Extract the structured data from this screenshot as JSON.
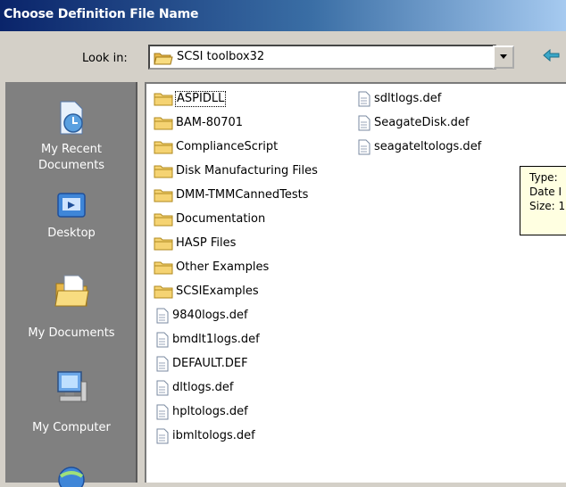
{
  "window": {
    "title": "Choose Definition File Name"
  },
  "lookin": {
    "label": "Look in:",
    "value": "SCSI toolbox32"
  },
  "places": [
    {
      "label_line1": "My Recent",
      "label_line2": "Documents",
      "icon": "recent-documents-icon"
    },
    {
      "label_line1": "Desktop",
      "label_line2": "",
      "icon": "desktop-icon"
    },
    {
      "label_line1": "My Documents",
      "label_line2": "",
      "icon": "my-documents-icon"
    },
    {
      "label_line1": "My Computer",
      "label_line2": "",
      "icon": "my-computer-icon"
    },
    {
      "label_line1": "",
      "label_line2": "",
      "icon": "network-icon"
    }
  ],
  "files": {
    "column1": [
      {
        "name": "ASPIDLL",
        "type": "folder"
      },
      {
        "name": "BAM-80701",
        "type": "folder"
      },
      {
        "name": "ComplianceScript",
        "type": "folder"
      },
      {
        "name": "Disk Manufacturing Files",
        "type": "folder"
      },
      {
        "name": "DMM-TMMCannedTests",
        "type": "folder"
      },
      {
        "name": "Documentation",
        "type": "folder"
      },
      {
        "name": "HASP Files",
        "type": "folder"
      },
      {
        "name": "Other Examples",
        "type": "folder"
      },
      {
        "name": "SCSIExamples",
        "type": "folder"
      },
      {
        "name": "9840logs.def",
        "type": "file"
      },
      {
        "name": "bmdlt1logs.def",
        "type": "file"
      },
      {
        "name": "DEFAULT.DEF",
        "type": "file"
      },
      {
        "name": "dltlogs.def",
        "type": "file"
      },
      {
        "name": "hpltologs.def",
        "type": "file"
      },
      {
        "name": "ibmltologs.def",
        "type": "file"
      }
    ],
    "column2": [
      {
        "name": "sdltlogs.def",
        "type": "file"
      },
      {
        "name": "SeagateDisk.def",
        "type": "file"
      },
      {
        "name": "seagateltologs.def",
        "type": "file"
      }
    ]
  },
  "tooltip": {
    "line1": "Type:",
    "line2": "Date I",
    "line3": "Size: 1"
  },
  "colors": {
    "title_start": "#0a246a",
    "title_end": "#a6caf0",
    "places_bg": "#808080",
    "folder": "#f5d372",
    "tooltip_bg": "#ffffe1"
  }
}
